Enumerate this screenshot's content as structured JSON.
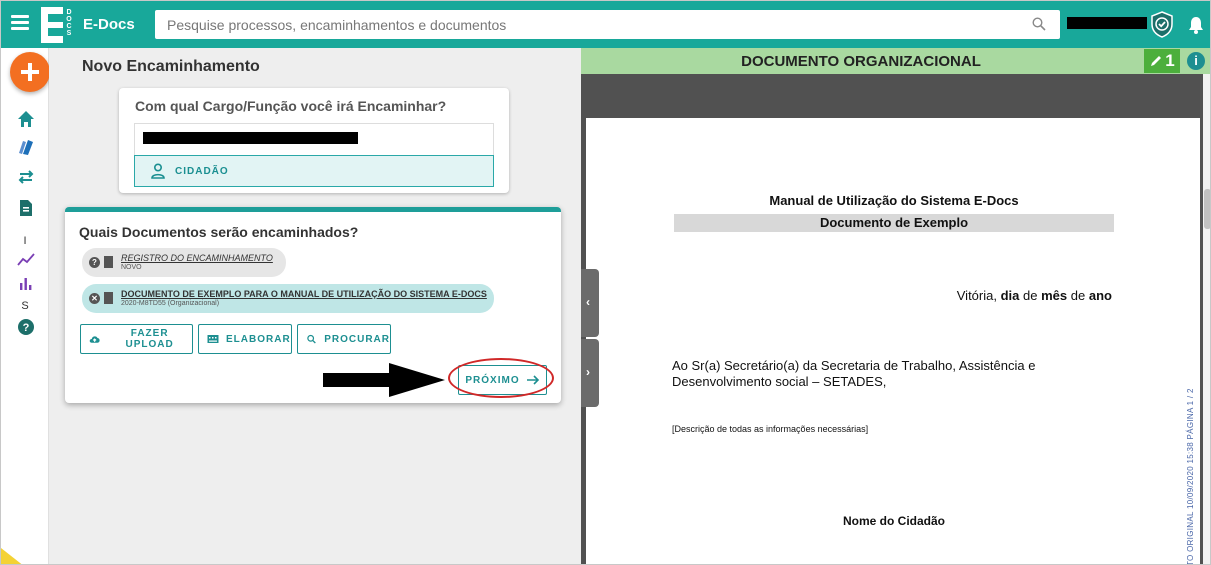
{
  "header": {
    "app_name": "E-Docs",
    "logo_letter": "E",
    "logo_vertical": "DOCS",
    "search_placeholder": "Pesquise processos, encaminhamentos e documentos"
  },
  "rail": {
    "letter_i": "I",
    "letter_s": "S"
  },
  "left": {
    "title": "Novo Encaminhamento",
    "role_question": "Com qual Cargo/Função você irá Encaminhar?",
    "role_option_citizen": "CIDADÃO",
    "docs_question": "Quais Documentos serão encaminhados?",
    "documents": [
      {
        "title": "REGISTRO DO ENCAMINHAMENTO",
        "subtitle": "NOVO"
      },
      {
        "title": "DOCUMENTO DE EXEMPLO PARA O MANUAL DE UTILIZAÇÃO DO SISTEMA E-DOCS",
        "subtitle": "2020-M8TD55 (Organizacional)"
      }
    ],
    "buttons": {
      "upload": "FAZER UPLOAD",
      "create": "ELABORAR",
      "search": "PROCURAR",
      "next": "PRÓXIMO"
    }
  },
  "viewer": {
    "header_title": "DOCUMENTO ORGANIZACIONAL",
    "edit_count": "1",
    "info_label": "i",
    "page": {
      "title": "Manual de Utilização do Sistema E-Docs",
      "subtitle": "Documento de Exemplo",
      "date_prefix": "Vitória,",
      "date_day": "dia",
      "date_de1": "de",
      "date_month": "mês",
      "date_de2": "de",
      "date_year": "ano",
      "recipient_line1": "Ao Sr(a) Secretário(a) da Secretaria de Trabalho, Assistência e",
      "recipient_line2": "Desenvolvimento social – SETADES,",
      "description": "[Descrição de todas as informações necessárias]",
      "signature": "Nome do Cidadão",
      "side_stamp": "TO ORIGINAL   10/09/2020 15:38   PÁGINA 1 / 2"
    }
  },
  "colors": {
    "primary": "#18a89a",
    "fab": "#f36f21",
    "doc_header": "#a9d9a0",
    "edit_badge": "#4caf3c",
    "highlight_ellipse": "#d02828"
  }
}
